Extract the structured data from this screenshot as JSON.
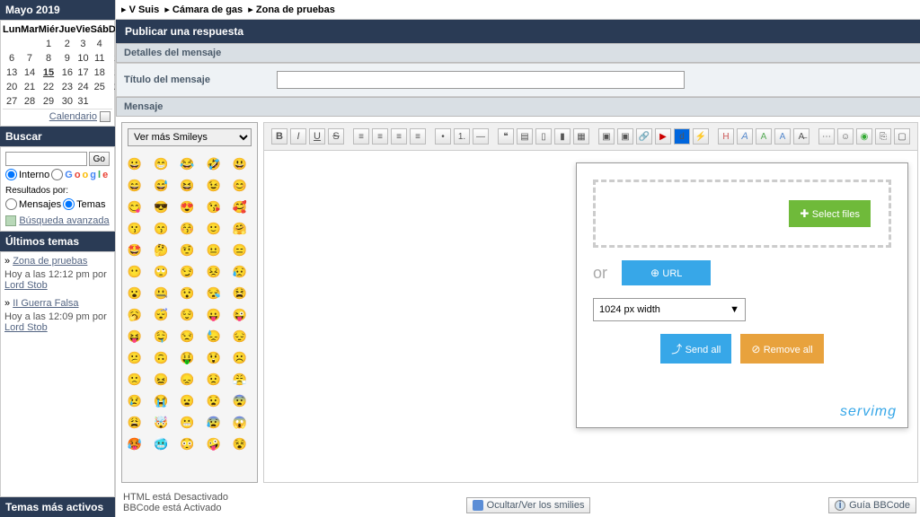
{
  "sidebar": {
    "cal": {
      "title": "Mayo 2019",
      "dow": [
        "Lun",
        "Mar",
        "Miér",
        "Jue",
        "Vie",
        "Sáb",
        "Dom"
      ],
      "footer": "Calendario"
    },
    "search": {
      "title": "Buscar",
      "go": "Go",
      "internal": "Interno",
      "google1": "G",
      "google2": "o",
      "google3": "o",
      "google4": "g",
      "google5": "l",
      "google6": "e",
      "results_by": "Resultados por:",
      "messages": "Mensajes",
      "topics": "Temas",
      "advanced": "Búsqueda avanzada"
    },
    "latest": {
      "title": "Últimos temas",
      "t1": "Zona de pruebas",
      "t1meta_a": "Hoy a las 12:12 pm por ",
      "t1meta_b": "Lord Stob",
      "t2": "II Guerra Falsa",
      "t2meta_a": "Hoy a las 12:09 pm por ",
      "t2meta_b": "Lord Stob"
    },
    "active": "Temas más activos"
  },
  "crumbs": {
    "a": "V Suis",
    "b": "Cámara de gas",
    "c": "Zona de pruebas"
  },
  "post": {
    "reply": "Publicar una respuesta",
    "details": "Detalles del mensaje",
    "title_label": "Título del mensaje",
    "title_value": "",
    "message": "Mensaje"
  },
  "smileys_label": "Ver más Smileys",
  "upload": {
    "select": "Select files",
    "or": "or",
    "url": "URL",
    "width": "1024 px width",
    "send": "Send all",
    "remove": "Remove all",
    "brand": "servimg"
  },
  "footer": {
    "html": "HTML está Desactivado",
    "bbcode": "BBCode está Activado",
    "hide_smilies": "Ocultar/Ver los smilies",
    "guide": "Guía BBCode"
  }
}
